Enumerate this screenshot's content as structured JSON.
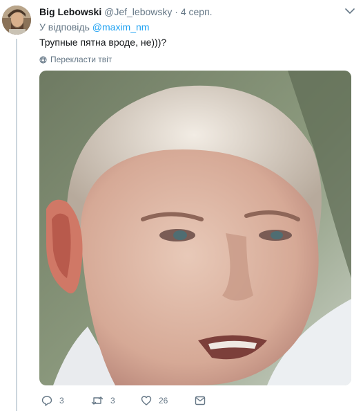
{
  "tweet": {
    "display_name": "Big Lebowski",
    "handle": "@Jef_lebowsky",
    "separator": "·",
    "date": "4 серп.",
    "reply_prefix": "У відповідь",
    "reply_to": "@maxim_nm",
    "text": "Трупные пятна вроде, не)))?",
    "translate_label": "Перекласти твіт"
  },
  "actions": {
    "replies": "3",
    "retweets": "3",
    "likes": "26"
  },
  "icons": [
    "chevron-down-icon",
    "globe-icon",
    "reply-icon",
    "retweet-icon",
    "like-icon",
    "direct-message-icon"
  ],
  "colors": {
    "link": "#1da1f2",
    "meta": "#657786",
    "text": "#14171a",
    "thread_line": "#ccd6dd"
  }
}
